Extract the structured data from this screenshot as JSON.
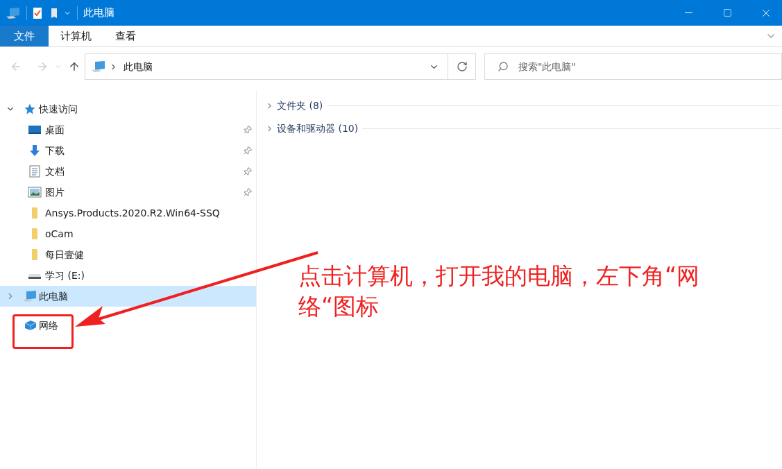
{
  "window": {
    "title": "此电脑"
  },
  "ribbon_tabs": [
    {
      "label": "文件",
      "selected": true
    },
    {
      "label": "计算机",
      "selected": false
    },
    {
      "label": "查看",
      "selected": false
    }
  ],
  "address_bar": {
    "path": "此电脑"
  },
  "search": {
    "placeholder": "搜索\"此电脑\""
  },
  "sidebar": {
    "items": [
      {
        "label": "快速访问",
        "kind": "star",
        "expanded": true,
        "selected": false,
        "children": [
          {
            "label": "桌面",
            "kind": "desktop",
            "pinned": true
          },
          {
            "label": "下载",
            "kind": "download",
            "pinned": true
          },
          {
            "label": "文档",
            "kind": "document",
            "pinned": true
          },
          {
            "label": "图片",
            "kind": "picture",
            "pinned": true
          },
          {
            "label": "Ansys.Products.2020.R2.Win64-SSQ",
            "kind": "folder",
            "pinned": false
          },
          {
            "label": "oCam",
            "kind": "folder",
            "pinned": false
          },
          {
            "label": "每日壹健",
            "kind": "folder",
            "pinned": false
          },
          {
            "label": "学习 (E:)",
            "kind": "drive",
            "pinned": false
          }
        ]
      },
      {
        "label": "此电脑",
        "kind": "computer",
        "expanded": false,
        "selected": true
      },
      {
        "label": "网络",
        "kind": "network",
        "selected": false
      }
    ]
  },
  "sections": [
    {
      "label": "文件夹 (8)"
    },
    {
      "label": "设备和驱动器 (10)"
    }
  ],
  "annotation": {
    "text": "点击计算机，打开我的电脑，左下角“网络“图标"
  }
}
